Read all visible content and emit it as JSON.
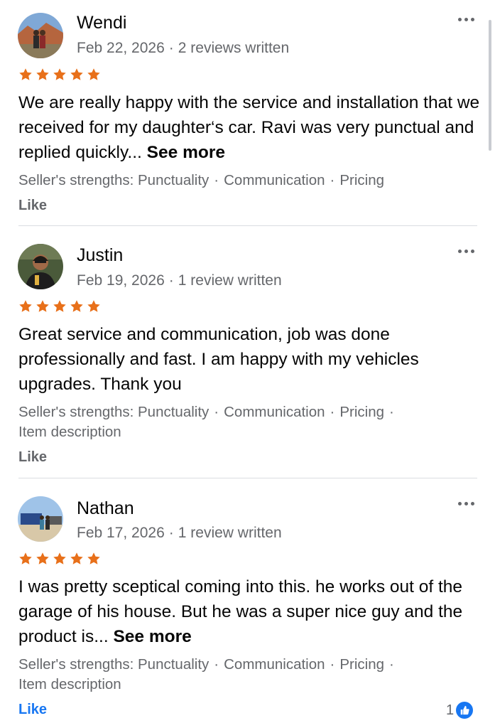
{
  "reviews": [
    {
      "name": "Wendi",
      "date": "Feb 22, 2026",
      "reviews_written": "2 reviews written",
      "rating": 5,
      "text": "We are really happy with the service and installation that we received for my daughter‘s car. Ravi was very punctual and replied quickly...",
      "see_more": "See more",
      "strengths_label": "Seller's strengths:",
      "strengths": [
        "Punctuality",
        "Communication",
        "Pricing"
      ],
      "like_label": "Like"
    },
    {
      "name": "Justin",
      "date": "Feb 19, 2026",
      "reviews_written": "1 review written",
      "rating": 5,
      "text": "Great service and communication, job was done professionally and fast. I am happy with my vehicles upgrades. Thank you",
      "strengths_label": "Seller's strengths:",
      "strengths": [
        "Punctuality",
        "Communication",
        "Pricing",
        "Item description"
      ],
      "like_label": "Like"
    },
    {
      "name": "Nathan",
      "date": "Feb 17, 2026",
      "reviews_written": "1 review written",
      "rating": 5,
      "text": "I was pretty sceptical coming into this.  he works out of the garage of his house. But he was a  super nice guy and the product is...",
      "see_more": "See more",
      "strengths_label": "Seller's strengths:",
      "strengths": [
        "Punctuality",
        "Communication",
        "Pricing",
        "Item description"
      ],
      "like_label": "Like",
      "reaction_count": "1"
    }
  ],
  "colors": {
    "star": "#e8701a",
    "like_active": "#1877f2",
    "secondary_text": "#65676b"
  },
  "icons": {
    "star": "star-icon",
    "more": "more-horizontal-icon",
    "reaction": "thumbs-up-icon"
  }
}
